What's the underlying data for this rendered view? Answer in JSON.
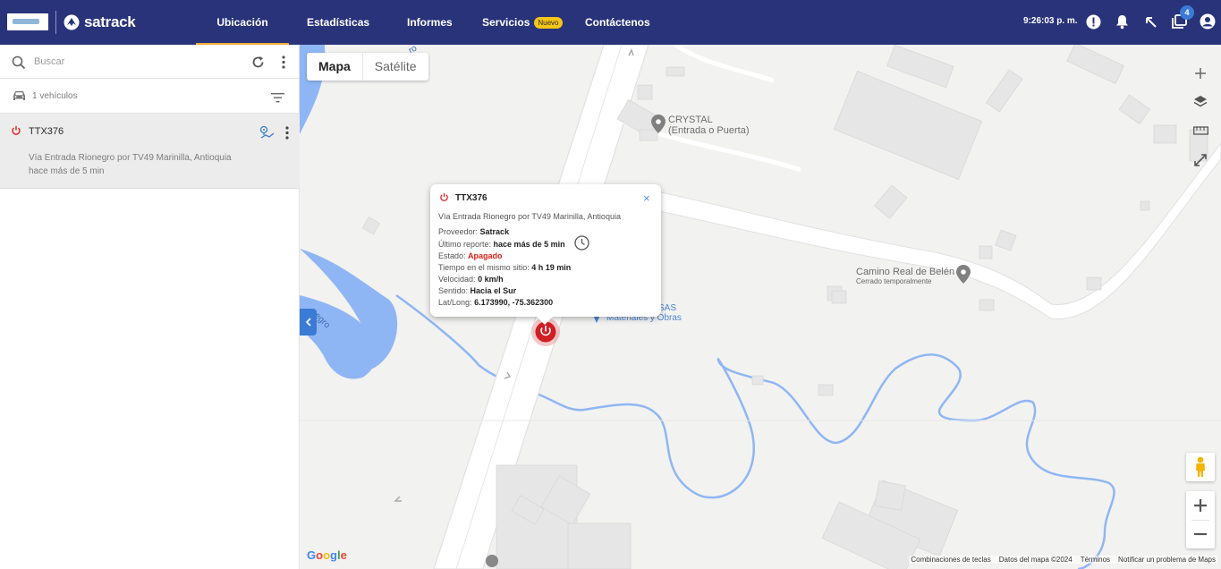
{
  "header": {
    "brand": "satrack",
    "nav": [
      {
        "label": "Ubicación",
        "active": true
      },
      {
        "label": "Estadísticas"
      },
      {
        "label": "Informes"
      },
      {
        "label": "Servicios",
        "badge": "Nuevo"
      },
      {
        "label": "Contáctenos"
      }
    ],
    "clock": "9:26:03 p. m.",
    "notification_count": "4",
    "icons": [
      "alert-icon",
      "bell-icon",
      "arrow-up-left-icon",
      "notifications-icon",
      "account-icon"
    ],
    "accent_color": "#29337a",
    "active_tab_color": "#f2a93b"
  },
  "sidebar": {
    "search_placeholder": "Buscar",
    "vehicle_count": "1 vehículos",
    "vehicles": [
      {
        "plate": "TTX376",
        "address": "Vía Entrada Rionegro por TV49 Marinilla, Antioquia",
        "last_report": "hace más de 5 min",
        "status_color": "#e0201a"
      }
    ]
  },
  "map": {
    "map_type": {
      "map": "Mapa",
      "satellite": "Satélite",
      "selected": "Mapa"
    },
    "places": [
      {
        "name": "CRYSTAL",
        "sub": "(Entrada o Puerta)"
      },
      {
        "name": "Camino Real de Belén",
        "sub": "Cerrado temporalmente"
      },
      {
        "name": "SAS",
        "sub": "Materiales y Obras"
      }
    ],
    "river_label": "egro",
    "river_label_2": "ro",
    "google": "Google",
    "footer": [
      "Combinaciones de teclas",
      "Datos del mapa ©2024",
      "Términos",
      "Notificar un problema de Maps"
    ]
  },
  "popup": {
    "plate": "TTX376",
    "address": "Vía Entrada Rionegro por TV49 Marinilla, Antioquia",
    "provider_label": "Proveedor:",
    "provider": "Satrack",
    "last_report_label": "Último reporte:",
    "last_report": "hace más de 5 min",
    "state_label": "Estado:",
    "state": "Apagado",
    "time_label": "Tiempo en el mismo sitio:",
    "time": "4 h 19 min",
    "speed_label": "Velocidad:",
    "speed": "0 km/h",
    "direction_label": "Sentido:",
    "direction": "Hacia el Sur",
    "latlong_label": "Lat/Long:",
    "latlong": "6.173990, -75.362300",
    "close": "×"
  }
}
